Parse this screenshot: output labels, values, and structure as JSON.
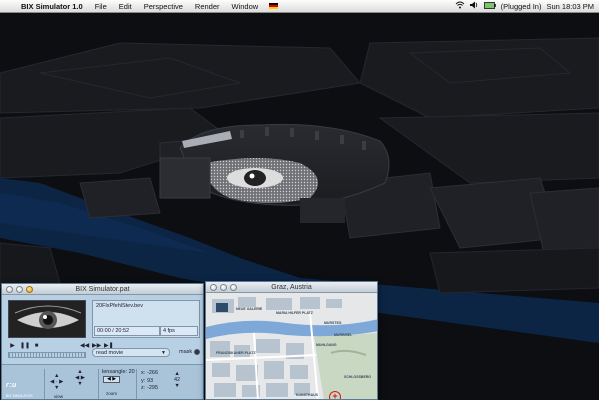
{
  "menubar": {
    "apple_glyph": "",
    "app_name": "BIX Simulator 1.0",
    "menus": [
      "File",
      "Edit",
      "Perspective",
      "Render",
      "Window"
    ],
    "battery_text": "(Plugged In)",
    "clock": "Sun 18:03 PM",
    "icons": [
      "wifi-icon",
      "volume-icon",
      "battery-icon",
      "flag-de-icon"
    ]
  },
  "bix_window": {
    "title": "BIX Simulator.pat",
    "file_name": "20FlxPfehlStev.bev",
    "timecode": "00:00 / 20:52",
    "fps": "4 fps",
    "mode_select": "read movie",
    "mask_label": "mask",
    "logo": "r:u",
    "logo_sub": "BIX SIMULATOR",
    "view_label": "view",
    "zoom_label": "zoom",
    "lens_label": "lensangle: 20",
    "coords": {
      "x_label": "x:",
      "x": "-266",
      "y_label": "y:",
      "y": "93",
      "z_label": "z:",
      "z": "-295",
      "angle": "42"
    }
  },
  "map_window": {
    "title": "Graz, Austria",
    "labels": [
      "MARIA HILFER PLATZ",
      "MURSTEG",
      "NEUE GALERIE",
      "FRANZISKANER PLATZ",
      "MUHLGANG",
      "SCHLOSSBERG",
      "KUNSTHAUS",
      "MURINSEL"
    ]
  },
  "colors": {
    "window_bg": "#b8d0e4",
    "river": "#7ea8d8",
    "target": "#d01818",
    "scene_bg": "#0d0e12"
  }
}
